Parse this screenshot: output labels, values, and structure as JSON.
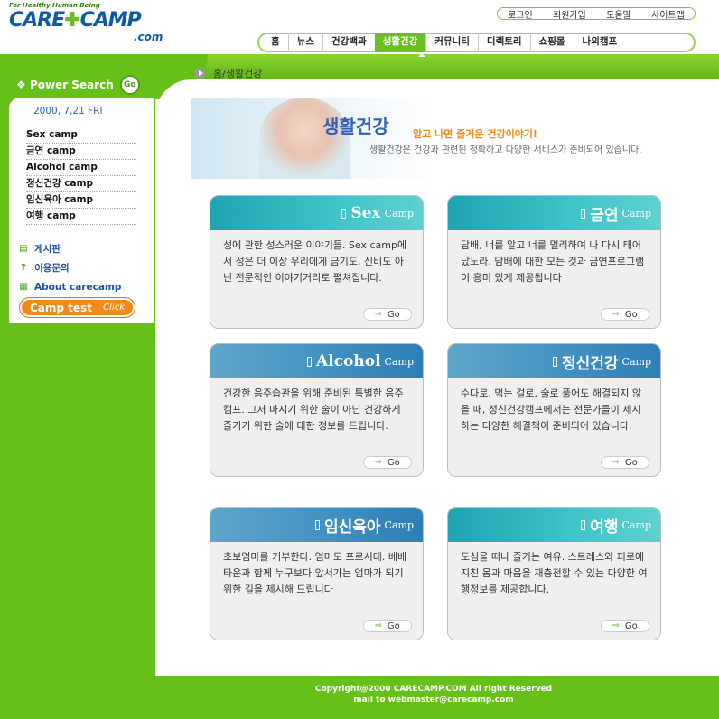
{
  "logo": {
    "tagline": "For Healthy Human Being",
    "name_a": "CARE",
    "name_b": "CAMP",
    "dotcom": ".com"
  },
  "util_links": [
    "로그인",
    "회원가입",
    "도움말",
    "사이트맵"
  ],
  "nav": [
    "홈",
    "뉴스",
    "건강백과",
    "생활건강",
    "커뮤니티",
    "디렉토리",
    "쇼핑몰",
    "나의캠프"
  ],
  "nav_active": "생활건강",
  "sidebar": {
    "power_search": "Power Search",
    "go": "Go",
    "date": "2000, 7,21 FRI",
    "camps": [
      "Sex camp",
      "금연 camp",
      "Alcohol camp",
      "정신건강 camp",
      "임신육아 camp",
      "여행 camp"
    ],
    "extra": [
      {
        "icon": "▤",
        "label": "게시판"
      },
      {
        "icon": "?",
        "label": "이용문의"
      },
      {
        "icon": "▦",
        "label": "About carecamp"
      }
    ],
    "camp_test": "Camp test",
    "camp_test_click": "Click"
  },
  "breadcrumb": "홈/생활건강",
  "banner": {
    "title": "생활건강",
    "subtitle": "알고 나면 즐거운 건강이야기!",
    "desc": "생활건강은 건강과 관련된 정확하고 다양한 서비스가 준비되어 있습니다."
  },
  "cards": [
    {
      "title": "Sex",
      "suffix": "Camp",
      "text": "성에 관한 성스러운 이야기들. Sex camp에서 성은 더 이상 우리에게 금기도, 신비도 아닌 전문적인 이야기거리로 펼쳐집니다.",
      "go": "Go"
    },
    {
      "title": "금연",
      "suffix": "Camp",
      "text": "담배, 너를 알고 너를 멀리하여 나 다시 태어났노라. 담배에 대한 모든 것과 금연프로그램이 흥미 있게 제공됩니다",
      "go": "Go"
    },
    {
      "title": "Alcohol",
      "suffix": "Camp",
      "text": "건강한 음주습관을 위해 준비된 특별한 음주캠프. 그저 마시기 위한 술이 아닌 건강하게 즐기기 위한 술에 대한 정보를 드립니다.",
      "go": "Go"
    },
    {
      "title": "정신건강",
      "suffix": "Camp",
      "text": "수다로, 먹는 걸로, 술로 풀어도 해결되지 않을 때, 정신건강캠프에서는 전문가들이 제시하는 다양한 해결책이 준비되어 있습니다.",
      "go": "Go"
    },
    {
      "title": "임신육아",
      "suffix": "Camp",
      "text": "초보엄마를 거부한다. 엄마도 프로시대. 베베타운과 함께 누구보다 앞서가는 엄마가 되기 위한 길을 제시해 드립니다",
      "go": "Go"
    },
    {
      "title": "여행",
      "suffix": "Camp",
      "text": "도심을 떠나 즐기는 여유. 스트레스와 피로에 지친 몸과 마음을 재충전할 수 있는 다양한 여행정보를 제공합니다.",
      "go": "Go"
    }
  ],
  "footer": {
    "line1": "Copyright@2000 CARECAMP.COM All right Reserved",
    "line2": "mail to webmaster@carecamp.com"
  }
}
